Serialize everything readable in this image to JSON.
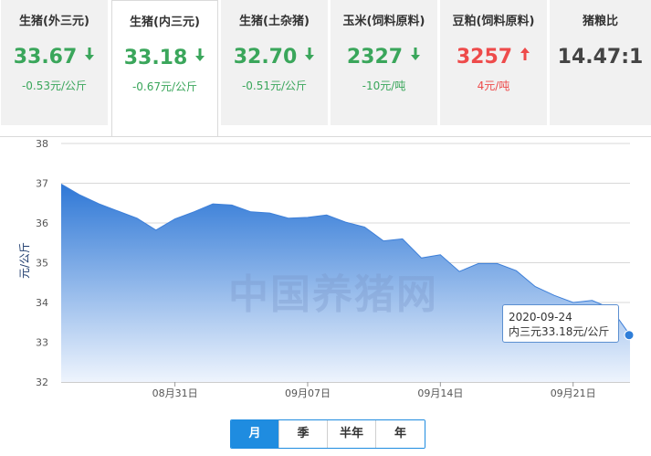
{
  "cards": [
    {
      "title": "生猪(外三元)",
      "price": "33.67",
      "change": "-0.53元/公斤",
      "trend": "down"
    },
    {
      "title": "生猪(内三元)",
      "price": "33.18",
      "change": "-0.67元/公斤",
      "trend": "down"
    },
    {
      "title": "生猪(土杂猪)",
      "price": "32.70",
      "change": "-0.51元/公斤",
      "trend": "down"
    },
    {
      "title": "玉米(饲料原料)",
      "price": "2327",
      "change": "-10元/吨",
      "trend": "down"
    },
    {
      "title": "豆粕(饲料原料)",
      "price": "3257",
      "change": "4元/吨",
      "trend": "up"
    },
    {
      "title": "猪粮比",
      "price": "14.47:1",
      "change": "",
      "trend": "none"
    }
  ],
  "colors": {
    "down": "#3aa65b",
    "up": "#ee4b4b",
    "accent": "#1f8ce0",
    "area_top": "#2f78d6",
    "area_bottom": "#eef4fd"
  },
  "icons": {
    "down": "arrow-down-icon",
    "up": "arrow-up-icon"
  },
  "watermark": "中国养猪网",
  "tooltip": {
    "date": "2020-09-24",
    "text": "内三元33.18元/公斤"
  },
  "tabs": [
    {
      "label": "月",
      "selected": true
    },
    {
      "label": "季",
      "selected": false
    },
    {
      "label": "半年",
      "selected": false
    },
    {
      "label": "年",
      "selected": false
    }
  ],
  "chart_data": {
    "type": "area",
    "ylabel": "元/公斤",
    "ylim": [
      32,
      38
    ],
    "yticks": [
      32,
      33,
      34,
      35,
      36,
      37,
      38
    ],
    "xlim": [
      "2020-08-25",
      "2020-09-24"
    ],
    "xticks": [
      {
        "date": "2020-08-31",
        "label": "08月31日"
      },
      {
        "date": "2020-09-07",
        "label": "09月07日"
      },
      {
        "date": "2020-09-14",
        "label": "09月14日"
      },
      {
        "date": "2020-09-21",
        "label": "09月21日"
      }
    ],
    "grid": true,
    "series": [
      {
        "points": [
          [
            "2020-08-25",
            36.98
          ],
          [
            "2020-08-26",
            36.7
          ],
          [
            "2020-08-27",
            36.48
          ],
          [
            "2020-08-28",
            36.3
          ],
          [
            "2020-08-29",
            36.12
          ],
          [
            "2020-08-30",
            35.82
          ],
          [
            "2020-08-31",
            36.1
          ],
          [
            "2020-09-01",
            36.28
          ],
          [
            "2020-09-02",
            36.48
          ],
          [
            "2020-09-03",
            36.45
          ],
          [
            "2020-09-04",
            36.28
          ],
          [
            "2020-09-05",
            36.25
          ],
          [
            "2020-09-06",
            36.12
          ],
          [
            "2020-09-07",
            36.14
          ],
          [
            "2020-09-08",
            36.2
          ],
          [
            "2020-09-09",
            36.02
          ],
          [
            "2020-09-10",
            35.9
          ],
          [
            "2020-09-11",
            35.55
          ],
          [
            "2020-09-12",
            35.6
          ],
          [
            "2020-09-13",
            35.12
          ],
          [
            "2020-09-14",
            35.2
          ],
          [
            "2020-09-15",
            34.78
          ],
          [
            "2020-09-16",
            34.98
          ],
          [
            "2020-09-17",
            34.98
          ],
          [
            "2020-09-18",
            34.8
          ],
          [
            "2020-09-19",
            34.4
          ],
          [
            "2020-09-20",
            34.18
          ],
          [
            "2020-09-21",
            34.0
          ],
          [
            "2020-09-22",
            34.05
          ],
          [
            "2020-09-23",
            33.85
          ],
          [
            "2020-09-24",
            33.18
          ]
        ],
        "highlight": "2020-09-24"
      }
    ]
  }
}
